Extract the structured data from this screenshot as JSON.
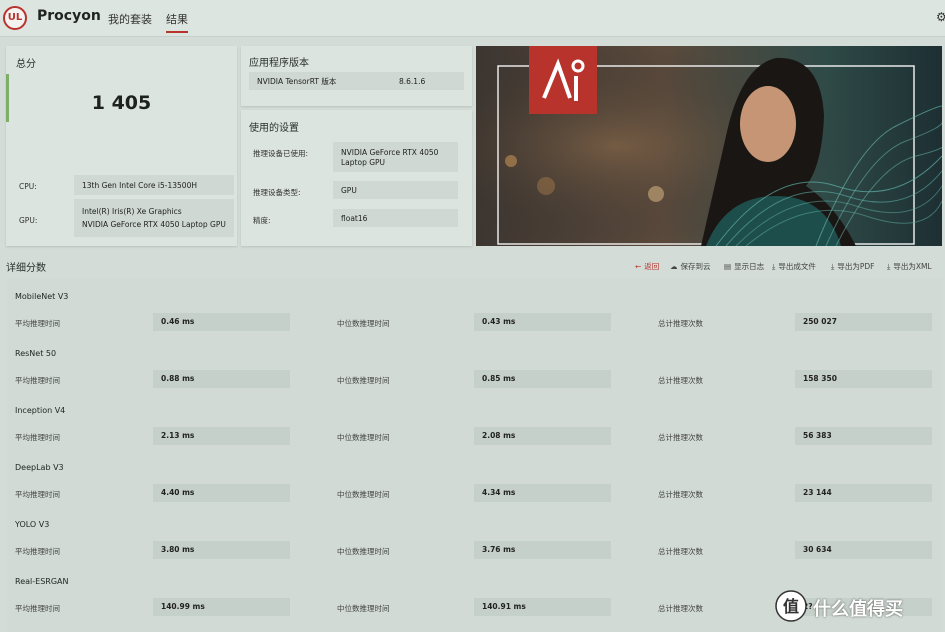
{
  "topbar": {
    "logo_text": "UL",
    "brand": "Procyon",
    "tabs": [
      {
        "label": "我的套装",
        "active": false
      },
      {
        "label": "结果",
        "active": true
      }
    ],
    "accent_color": "#b8332c"
  },
  "score_panel": {
    "title": "总分",
    "score": "1 405",
    "cpu_label": "CPU:",
    "cpu_value": "13th Gen Intel Core i5-13500H",
    "gpu_label": "GPU:",
    "gpu_values": [
      "Intel(R) Iris(R) Xe Graphics",
      "NVIDIA GeForce RTX 4050 Laptop GPU"
    ]
  },
  "version_panel": {
    "title": "应用程序版本",
    "name": "NVIDIA TensorRT 版本",
    "value": "8.6.1.6"
  },
  "settings_panel": {
    "title": "使用的设置",
    "rows": [
      {
        "label": "推理设备已使用:",
        "value_lines": [
          "NVIDIA GeForce RTX 4050",
          "Laptop GPU"
        ]
      },
      {
        "label": "推理设备类型:",
        "value_lines": [
          "GPU"
        ]
      },
      {
        "label": "精度:",
        "value_lines": [
          "float16"
        ]
      }
    ]
  },
  "details": {
    "title": "详细分数",
    "actions": [
      {
        "label": "返回",
        "icon": "back-arrow-icon"
      },
      {
        "label": "保存到云",
        "icon": "cloud-icon"
      },
      {
        "label": "显示日志",
        "icon": "document-icon"
      },
      {
        "label": "导出成文件",
        "icon": "download-icon"
      },
      {
        "label": "导出为PDF",
        "icon": "download-icon"
      },
      {
        "label": "导出为XML",
        "icon": "download-icon"
      }
    ],
    "col_labels": [
      "平均推理时间",
      "中位数推理时间",
      "总计推理次数"
    ],
    "benchmarks": [
      {
        "name": "MobileNet V3",
        "avg": "0.46 ms",
        "median": "0.43 ms",
        "total": "250 027"
      },
      {
        "name": "ResNet 50",
        "avg": "0.88 ms",
        "median": "0.85 ms",
        "total": "158 350"
      },
      {
        "name": "Inception V4",
        "avg": "2.13 ms",
        "median": "2.08 ms",
        "total": "56 383"
      },
      {
        "name": "DeepLab V3",
        "avg": "4.40 ms",
        "median": "4.34 ms",
        "total": "23 144"
      },
      {
        "name": "YOLO V3",
        "avg": "3.80 ms",
        "median": "3.76 ms",
        "total": "30 634"
      },
      {
        "name": "Real-ESRGAN",
        "avg": "140.99 ms",
        "median": "140.91 ms",
        "total": "2?"
      }
    ]
  },
  "watermark": {
    "text": "什么值得买"
  }
}
